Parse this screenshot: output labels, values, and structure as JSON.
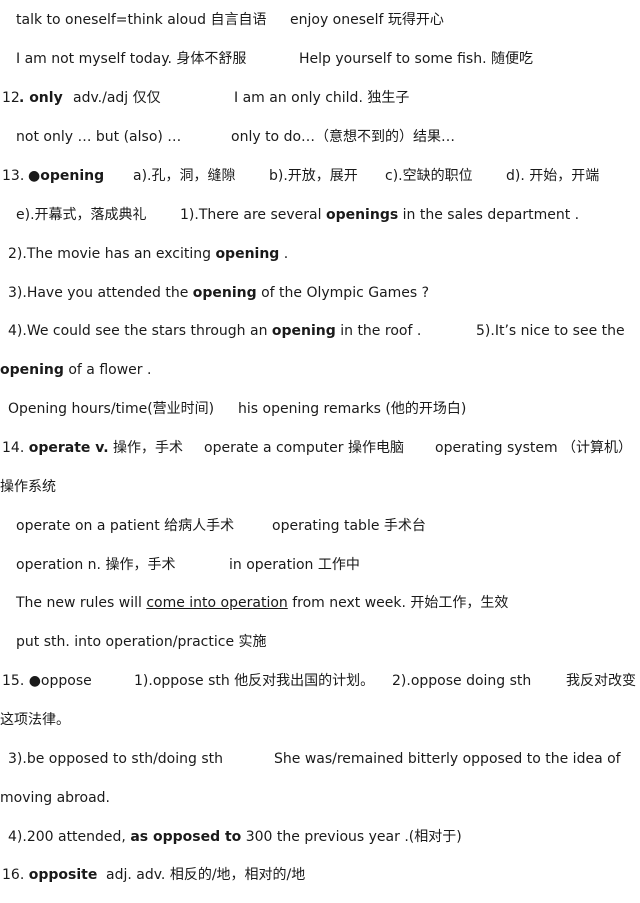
{
  "lines": [
    {
      "segs": [
        {
          "t": "talk to oneself=think aloud 自言自语"
        },
        {
          "t": "enjoy oneself 玩得开心"
        }
      ]
    },
    {
      "segs": [
        {
          "t": "I am not myself today. 身体不舒服"
        },
        {
          "t": "Help yourself to some fish. 随便吃"
        }
      ]
    },
    {
      "segs": [
        {
          "t": "12",
          "b": false
        },
        {
          "t": ". only",
          "b": true
        },
        {
          "t": "adv./adj 仅仅"
        },
        {
          "t": "I am an only child. 独生子"
        }
      ]
    },
    {
      "segs": [
        {
          "t": "not only … but (also) …"
        },
        {
          "t": "only to do…（意想不到的）结果…"
        }
      ]
    },
    {
      "segs": [
        {
          "t": "13. "
        },
        {
          "t": "●opening",
          "b": true
        },
        {
          "t": "a).孔，洞，缝隙"
        },
        {
          "t": "b).开放，展开"
        },
        {
          "t": "c).空缺的职位"
        },
        {
          "t": "d). 开始，开端"
        }
      ]
    },
    {
      "segs": [
        {
          "t": "e).开幕式，落成典礼"
        },
        {
          "t": "1).There are several "
        },
        {
          "t": "openings",
          "b": true
        },
        {
          "t": " in the sales department ."
        }
      ]
    },
    {
      "segs": [
        {
          "t": "2).The movie has an exciting "
        },
        {
          "t": "opening",
          "b": true
        },
        {
          "t": " ."
        }
      ]
    },
    {
      "segs": [
        {
          "t": "3).Have you attended the "
        },
        {
          "t": "opening",
          "b": true
        },
        {
          "t": " of the Olympic Games ?"
        }
      ]
    },
    {
      "segs": [
        {
          "t": "4).We could see the stars through an "
        },
        {
          "t": "opening",
          "b": true
        },
        {
          "t": " in the roof ."
        },
        {
          "t": "5).It’s nice to see the"
        }
      ]
    },
    {
      "segs": [
        {
          "t": "opening",
          "b": true
        },
        {
          "t": " of a flower ."
        }
      ]
    },
    {
      "segs": [
        {
          "t": "Opening hours/time(营业时间)"
        },
        {
          "t": "his opening remarks (他的开场白)"
        }
      ]
    },
    {
      "segs": [
        {
          "t": "14. "
        },
        {
          "t": "operate v.",
          "b": true
        },
        {
          "t": " 操作，手术"
        },
        {
          "t": "operate a computer 操作电脑"
        },
        {
          "t": "operating system （计算机）"
        }
      ]
    },
    {
      "segs": [
        {
          "t": "操作系统"
        }
      ]
    },
    {
      "segs": [
        {
          "t": "operate on a patient 给病人手术"
        },
        {
          "t": "operating table 手术台"
        }
      ]
    },
    {
      "segs": [
        {
          "t": "operation n. 操作，手术"
        },
        {
          "t": "in operation 工作中"
        }
      ]
    },
    {
      "segs": [
        {
          "t": "The new rules will "
        },
        {
          "t": "come into operation",
          "u": true
        },
        {
          "t": " from next week. 开始工作，生效"
        }
      ]
    },
    {
      "segs": [
        {
          "t": "put sth. into operation/practice 实施"
        }
      ]
    },
    {
      "segs": [
        {
          "t": "15. ●oppose"
        },
        {
          "t": "1).oppose sth 他反对我出国的计划。"
        },
        {
          "t": "2).oppose doing sth"
        },
        {
          "t": "我反对改变"
        }
      ]
    },
    {
      "segs": [
        {
          "t": "这项法律。"
        }
      ]
    },
    {
      "segs": [
        {
          "t": "3).be opposed to sth/doing sth"
        },
        {
          "t": "She was/remained bitterly opposed to the idea of"
        }
      ]
    },
    {
      "segs": [
        {
          "t": "moving abroad."
        }
      ]
    },
    {
      "segs": [
        {
          "t": "4).200 attended, "
        },
        {
          "t": "as opposed to",
          "b": true
        },
        {
          "t": " 300 the previous year .(相对于)"
        }
      ]
    },
    {
      "segs": [
        {
          "t": "16. "
        },
        {
          "t": "opposite",
          "b": true
        },
        {
          "t": "adj. adv. 相反的/地，相对的/地"
        }
      ]
    }
  ]
}
